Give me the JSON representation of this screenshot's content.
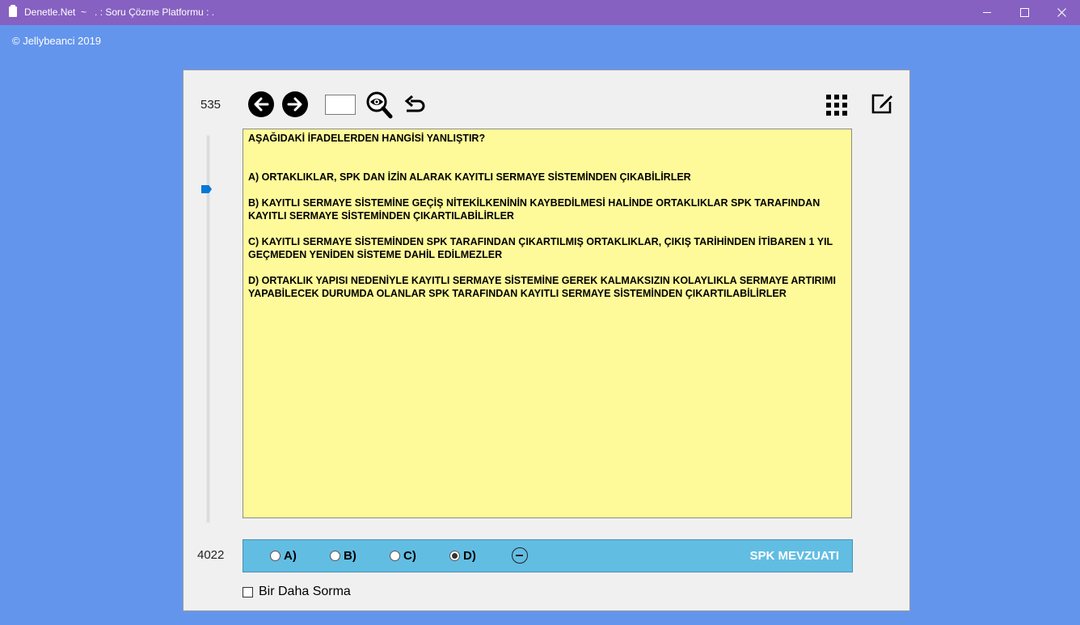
{
  "window": {
    "title": "Denetle.Net  ~   . : Soru Çözme Platformu : .",
    "icons": {
      "app": "app-icon",
      "minimize": "minimize-icon",
      "maximize": "maximize-icon",
      "close": "close-icon"
    }
  },
  "copyright": "© Jellybeanci 2019",
  "navigator": {
    "current_number": "535",
    "total_number": "4022",
    "goto_value": "",
    "slider_position_fraction": 0.133,
    "icons": {
      "back": "arrow-left-circle-icon",
      "forward": "arrow-right-circle-icon",
      "search": "magnifier-eye-icon",
      "undo": "undo-icon",
      "grid": "grid-icon",
      "edit": "edit-icon"
    }
  },
  "question": {
    "stem": "AŞAĞIDAKİ İFADELERDEN HANGİSİ YANLIŞTIR?",
    "options": [
      "A) ORTAKLIKLAR, SPK DAN İZİN ALARAK KAYITLI SERMAYE SİSTEMİNDEN ÇIKABİLİRLER",
      "B) KAYITLI SERMAYE SİSTEMİNE GEÇİŞ NİTEKİLKENİNİN KAYBEDİLMESİ HALİNDE ORTAKLIKLAR SPK TARAFINDAN KAYITLI SERMAYE SİSTEMİNDEN ÇIKARTILABİLİRLER",
      "C) KAYITLI SERMAYE SİSTEMİNDEN SPK TARAFINDAN ÇIKARTILMIŞ ORTAKLIKLAR, ÇIKIŞ TARİHİNDEN İTİBAREN 1 YIL GEÇMEDEN YENİDEN SİSTEME DAHİL EDİLMEZLER",
      "D) ORTAKLIK YAPISI NEDENİYLE KAYITLI SERMAYE SİSTEMİNE GEREK KALMAKSIZIN KOLAYLIKLA SERMAYE ARTIRIMI YAPABİLECEK DURUMDA OLANLAR SPK TARAFINDAN KAYITLI SERMAYE SİSTEMİNDEN ÇIKARTILABİLİRLER"
    ]
  },
  "answers": {
    "labels": [
      "A)",
      "B)",
      "C)",
      "D)"
    ],
    "selected": "D)",
    "clear_icon": "minus-circle-icon",
    "topic": "SPK MEVZUATI"
  },
  "dont_ask_again": {
    "label": "Bir Daha Sorma",
    "checked": false
  },
  "colors": {
    "background": "#6495ed",
    "titlebar": "#8661c1",
    "question_bg": "#fffa99",
    "answer_bar": "#62bde3",
    "slider_thumb": "#0078d7"
  }
}
